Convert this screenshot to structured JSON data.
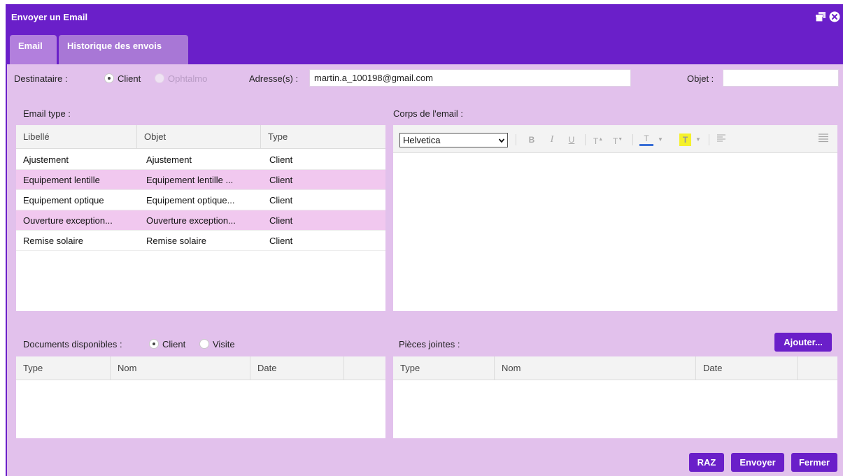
{
  "window": {
    "title": "Envoyer un Email"
  },
  "tabs": [
    {
      "label": "Email"
    },
    {
      "label": "Historique des envois"
    }
  ],
  "recipient": {
    "label": "Destinataire :",
    "options": [
      {
        "label": "Client",
        "selected": true
      },
      {
        "label": "Ophtalmo",
        "selected": false,
        "disabled": true
      }
    ],
    "address_label": "Adresse(s) :",
    "address_value": "martin.a_100198@gmail.com",
    "subject_label": "Objet :",
    "subject_value": ""
  },
  "email_types": {
    "label": "Email type :",
    "columns": [
      "Libellé",
      "Objet",
      "Type"
    ],
    "rows": [
      [
        "Ajustement",
        "Ajustement",
        "Client"
      ],
      [
        "Equipement lentille",
        "Equipement lentille ...",
        "Client"
      ],
      [
        "Equipement optique",
        "Equipement optique...",
        "Client"
      ],
      [
        "Ouverture exception...",
        "Ouverture exception...",
        "Client"
      ],
      [
        "Remise solaire",
        "Remise solaire",
        "Client"
      ]
    ]
  },
  "body_editor": {
    "label": "Corps de l'email :",
    "font_value": "Helvetica",
    "toolbar": {
      "bold": "B",
      "italic": "I",
      "underline": "U",
      "superscript": "T",
      "subscript": "T",
      "text_color": "T",
      "highlight": "T"
    }
  },
  "documents": {
    "label": "Documents disponibles :",
    "options": [
      {
        "label": "Client",
        "selected": true
      },
      {
        "label": "Visite",
        "selected": false
      }
    ],
    "columns": [
      "Type",
      "Nom",
      "Date"
    ]
  },
  "attachments": {
    "label": "Pièces jointes :",
    "add_button": "Ajouter...",
    "columns": [
      "Type",
      "Nom",
      "Date"
    ]
  },
  "footer": {
    "reset_button": "RAZ",
    "send_button": "Envoyer",
    "close_button": "Fermer"
  },
  "colors": {
    "accent": "#6a1fc9",
    "background": "#e2c1ec",
    "row_highlight": "#f1c8ef"
  },
  "icons": {
    "restore": "restore-window-icon",
    "close": "close-circle-icon"
  }
}
